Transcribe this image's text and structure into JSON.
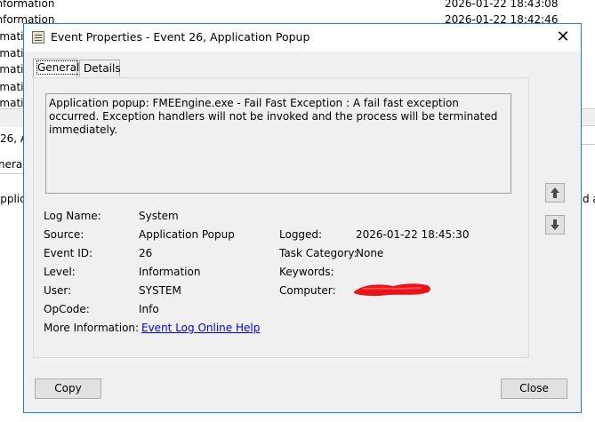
{
  "background": {
    "rows": [
      {
        "level": "Information",
        "time": "2026-01-22 18:43:08"
      },
      {
        "level": "Information",
        "time": "2026-01-22 18:42:46"
      },
      {
        "level": "Information"
      },
      {
        "level": "Information"
      },
      {
        "level": "Information"
      },
      {
        "level": "Information"
      },
      {
        "level": "Information"
      }
    ],
    "left_fragments": {
      "event": "26, A",
      "general": "neral",
      "applic": "Applic"
    },
    "right_fragment": "d an"
  },
  "dialog": {
    "title": "Event Properties - Event 26, Application Popup",
    "close_glyph": "✕",
    "tabs": [
      {
        "label": "General",
        "active": true
      },
      {
        "label": "Details",
        "active": false
      }
    ],
    "message": "Application popup: FMEEngine.exe - Fail Fast Exception : A fail fast exception occurred. Exception handlers will not be invoked and the process will be terminated immediately.",
    "fields": {
      "log_name": {
        "label": "Log Name:",
        "value": "System"
      },
      "source": {
        "label": "Source:",
        "value": "Application Popup"
      },
      "event_id": {
        "label": "Event ID:",
        "value": "26"
      },
      "level": {
        "label": "Level:",
        "value": "Information"
      },
      "user": {
        "label": "User:",
        "value": "SYSTEM"
      },
      "opcode": {
        "label": "OpCode:",
        "value": "Info"
      },
      "more_info": {
        "label": "More Information:",
        "value": "Event Log Online Help"
      },
      "logged": {
        "label": "Logged:",
        "value": "2026-01-22 18:45:30"
      },
      "task_category": {
        "label": "Task Category:",
        "value": "None"
      },
      "keywords": {
        "label": "Keywords:",
        "value": ""
      },
      "computer": {
        "label": "Computer:",
        "value": ""
      }
    },
    "buttons": {
      "copy": "Copy",
      "close": "Close"
    },
    "icons": {
      "up": "up-arrow-icon",
      "down": "down-arrow-icon",
      "title": "event-properties-icon"
    },
    "colors": {
      "window_border": "#1883d7",
      "link": "#0000ee",
      "redaction": "#e8141c"
    }
  }
}
